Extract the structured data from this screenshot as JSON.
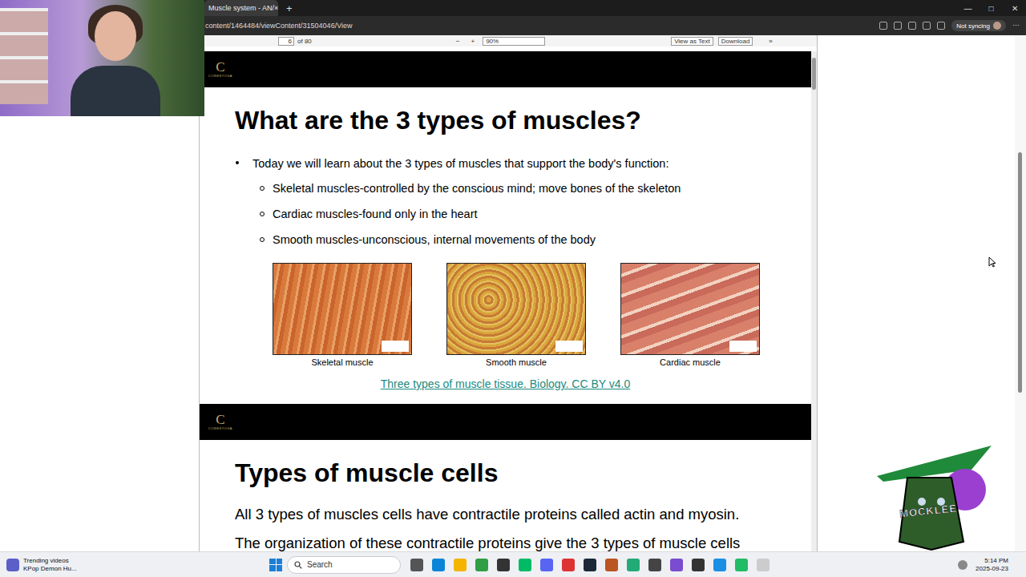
{
  "browser": {
    "tabs": [
      {
        "label": "Muscle system - AN/",
        "close": "×",
        "selected": true
      }
    ],
    "new_tab": "+",
    "window_controls": [
      "—",
      "□",
      "✕"
    ],
    "address": "content/1464484/viewContent/31504046/View",
    "profile": "Not syncing",
    "more": "⋯"
  },
  "pdf_toolbar": {
    "page": "6",
    "page_count": "of 80",
    "zoom_out": "−",
    "zoom_in": "+",
    "zoom": "90%",
    "buttons": [
      "View as Text",
      "Download"
    ],
    "overflow": "»"
  },
  "slides": [
    {
      "logo": "C",
      "logo_text": "CONESTOGA",
      "title": "What are the 3 types of muscles?",
      "intro": "Today we will learn about the 3 types of muscles that support the body's function:",
      "bullets": [
        "Skeletal muscles-controlled by the conscious mind; move bones of the skeleton",
        "Cardiac muscles-found only in the heart",
        "Smooth muscles-unconscious, internal movements of the body"
      ],
      "figures": [
        {
          "caption": "Skeletal muscle",
          "kind": "skeletal"
        },
        {
          "caption": "Smooth muscle",
          "kind": "smooth"
        },
        {
          "caption": "Cardiac muscle",
          "kind": "cardiac"
        }
      ],
      "link": "Three types of muscle tissue. Biology. CC BY v4.0"
    },
    {
      "logo": "C",
      "logo_text": "CONESTOGA",
      "title": "Types of muscle cells",
      "paragraphs": [
        "All 3 types of muscles cells have contractile proteins called actin and myosin.",
        "The organization of these contractile proteins give the 3 types of muscle cells"
      ]
    }
  ],
  "taskbar": {
    "widget": {
      "title": "Trending videos",
      "subtitle": "KPop Demon Hu..."
    },
    "search": "Search",
    "clock": {
      "time": "5:14 PM",
      "date": "2025-09-23"
    }
  },
  "overlay_logo": {
    "text": "MOCKLEE"
  }
}
